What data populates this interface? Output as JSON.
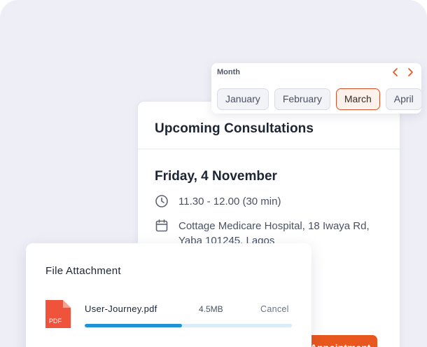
{
  "colors": {
    "accent": "#e8571e",
    "progress": "#1d94d8",
    "pdf_red": "#f0533c"
  },
  "consultations": {
    "title": "Upcoming Consultations",
    "date": "Friday, 4 November",
    "time": "11.30 - 12.00 (30 min)",
    "location": "Cottage Medicare Hospital, 18 Iwaya Rd, Yaba 101245, Lagos",
    "appointment_button": "Appointment",
    "time_icon": "clock-icon",
    "location_icon": "calendar-icon"
  },
  "month_picker": {
    "label": "Month",
    "prev_icon": "chevron-left-icon",
    "next_icon": "chevron-right-icon",
    "months": [
      "January",
      "February",
      "March",
      "April"
    ],
    "selected": "March"
  },
  "attachment": {
    "title": "File Attachment",
    "file_icon": "pdf-file-icon",
    "file_badge": "PDF",
    "file_name": "User-Journey.pdf",
    "file_size": "4.5MB",
    "cancel_label": "Cancel",
    "progress": 0.47
  }
}
